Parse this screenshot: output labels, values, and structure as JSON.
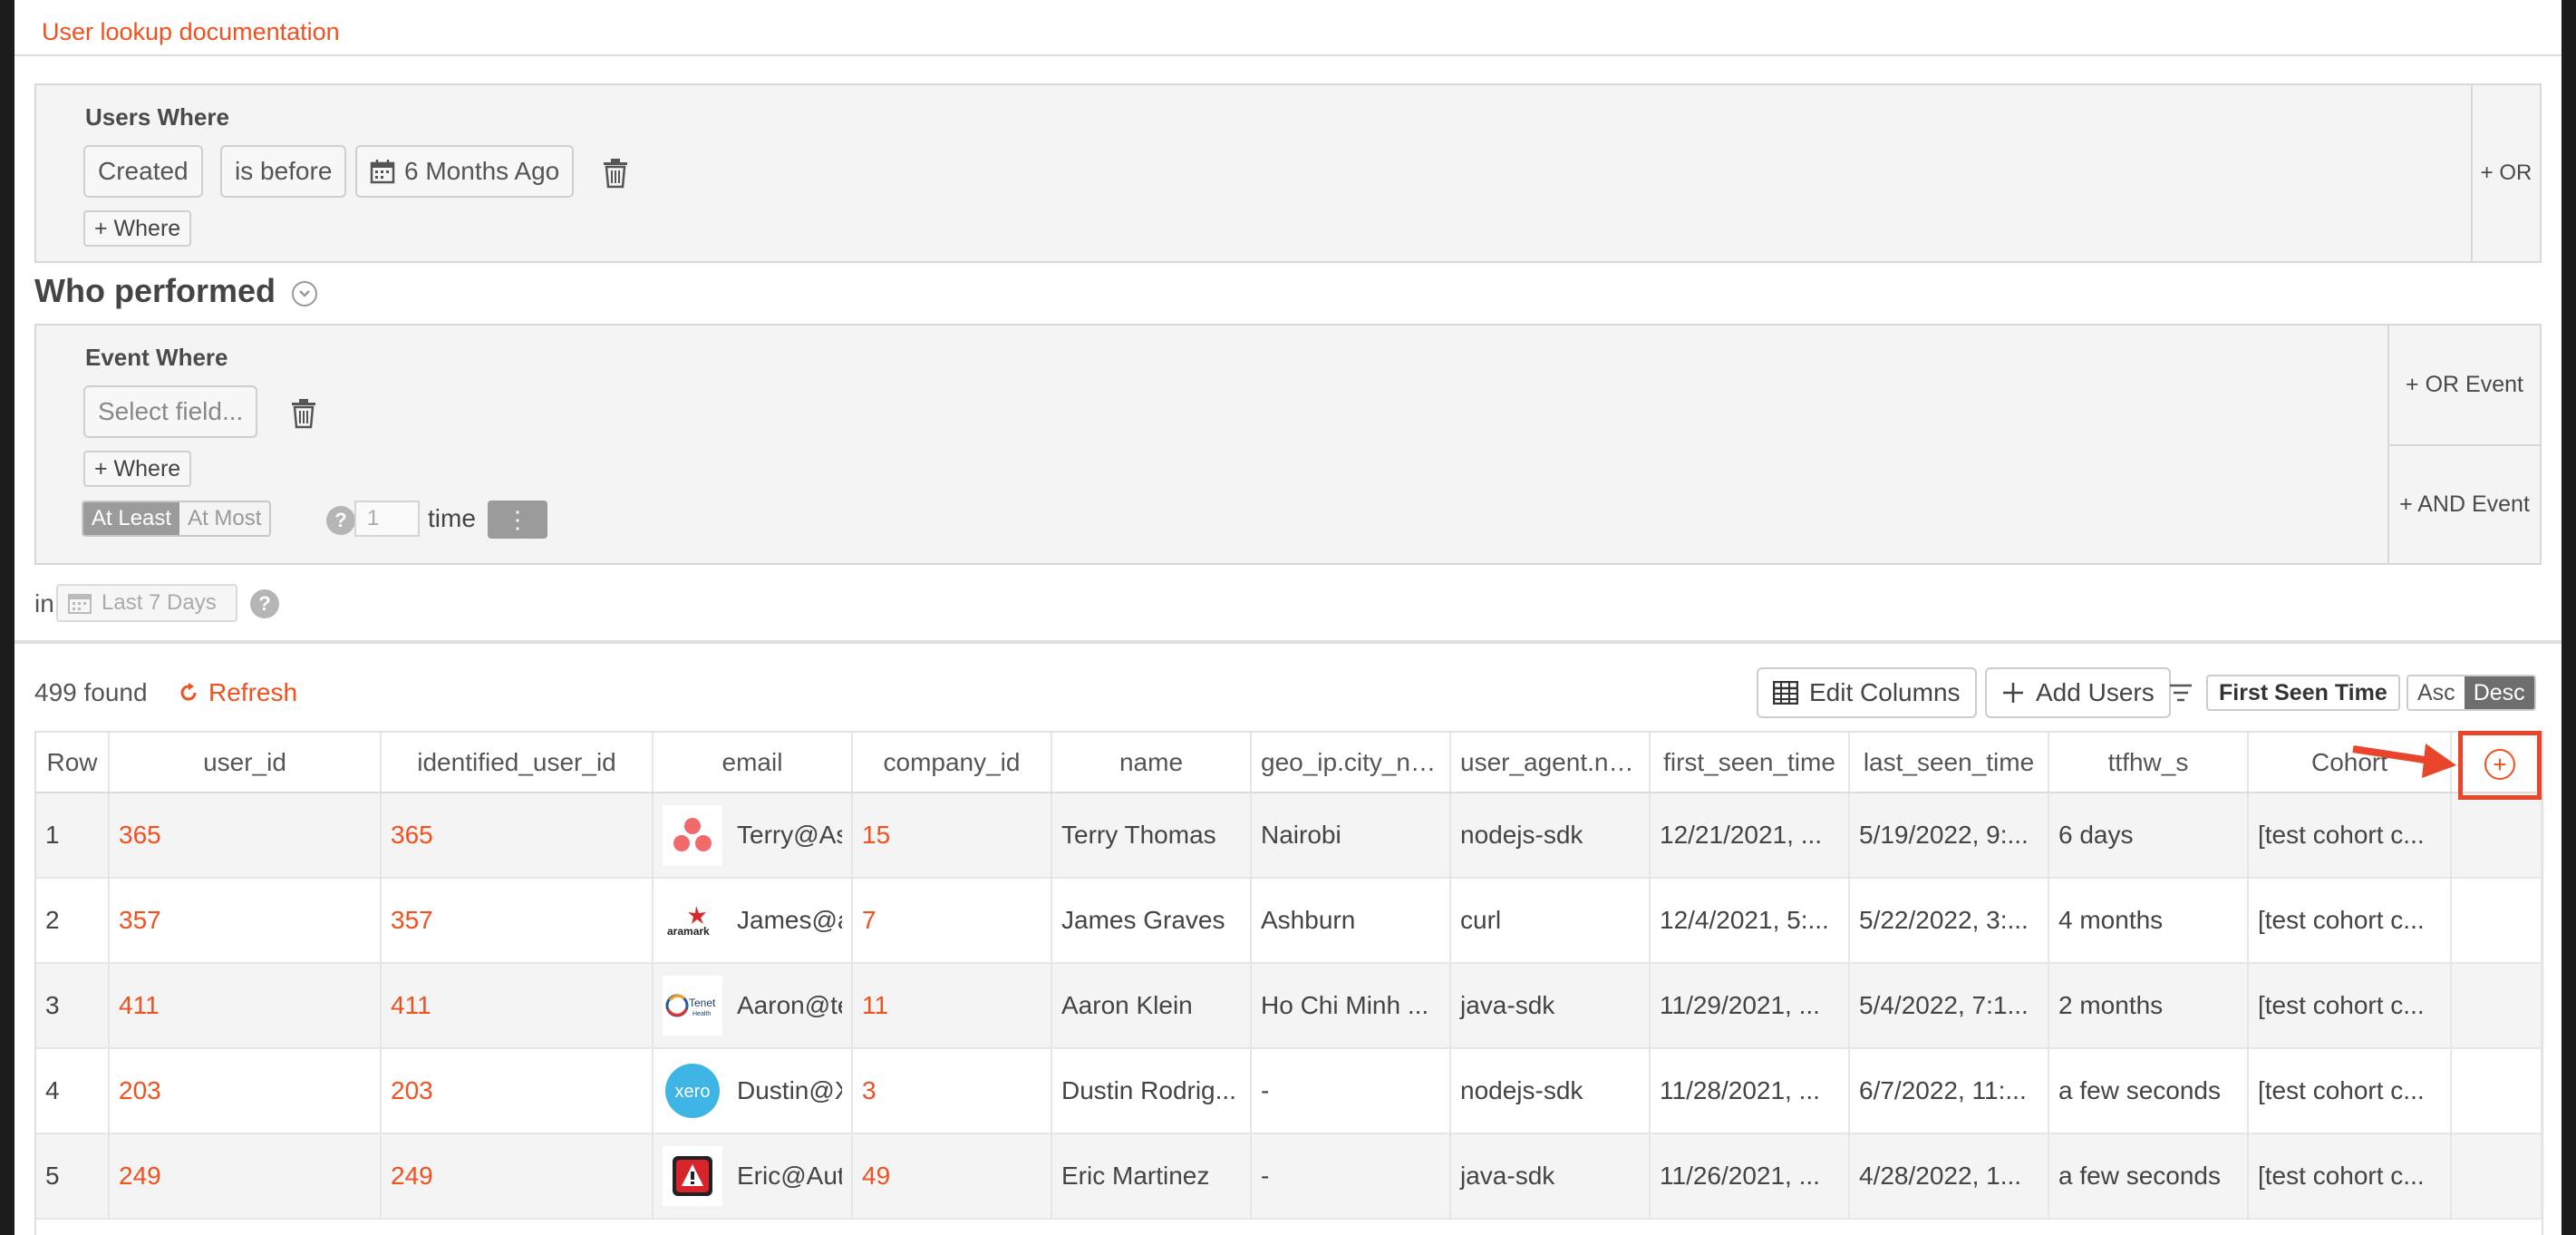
{
  "header": {
    "docs_link": "User lookup documentation"
  },
  "users_where": {
    "label": "Users Where",
    "field": "Created",
    "operator": "is before",
    "value": "6 Months Ago",
    "add_where": "+ Where",
    "or_label": "+ OR"
  },
  "who_performed": {
    "title": "Who performed",
    "event_label": "Event Where",
    "select_placeholder": "Select field...",
    "add_where": "+ Where",
    "at_least": "At Least",
    "at_most": "At Most",
    "count_placeholder": "1",
    "time_label": "time",
    "kebab": "⋮",
    "or_event": "+ OR Event",
    "and_event": "+ AND Event",
    "in_label": "in",
    "range": "Last 7 Days"
  },
  "results": {
    "found": "499 found",
    "refresh": "Refresh",
    "edit_columns": "Edit Columns",
    "add_users": "Add Users",
    "sort_field": "First Seen Time",
    "asc": "Asc",
    "desc": "Desc",
    "add_column_icon": "+"
  },
  "table": {
    "columns": [
      "Row",
      "user_id",
      "identified_user_id",
      "email",
      "company_id",
      "name",
      "geo_ip.city_na...",
      "user_agent.na...",
      "first_seen_time",
      "last_seen_time",
      "ttfhw_s",
      "Cohort"
    ],
    "rows": [
      {
        "row": "1",
        "user_id": "365",
        "identified_user_id": "365",
        "email": "Terry@Asa",
        "company_id": "15",
        "name": "Terry Thomas",
        "city": "Nairobi",
        "agent": "nodejs-sdk",
        "first_seen": "12/21/2021, ...",
        "last_seen": "5/19/2022, 9:...",
        "ttfhw": "6 days",
        "cohort": "[test cohort c...",
        "logo": "asana-logo"
      },
      {
        "row": "2",
        "user_id": "357",
        "identified_user_id": "357",
        "email": "James@a",
        "company_id": "7",
        "name": "James Graves",
        "city": "Ashburn",
        "agent": "curl",
        "first_seen": "12/4/2021, 5:...",
        "last_seen": "5/22/2022, 3:...",
        "ttfhw": "4 months",
        "cohort": "[test cohort c...",
        "logo": "aramark-logo"
      },
      {
        "row": "3",
        "user_id": "411",
        "identified_user_id": "411",
        "email": "Aaron@te",
        "company_id": "11",
        "name": "Aaron Klein",
        "city": "Ho Chi Minh ...",
        "agent": "java-sdk",
        "first_seen": "11/29/2021, ...",
        "last_seen": "5/4/2022, 7:1...",
        "ttfhw": "2 months",
        "cohort": "[test cohort c...",
        "logo": "tenet-logo"
      },
      {
        "row": "4",
        "user_id": "203",
        "identified_user_id": "203",
        "email": "Dustin@Xe",
        "company_id": "3",
        "name": "Dustin Rodrig...",
        "city": "-",
        "agent": "nodejs-sdk",
        "first_seen": "11/28/2021, ...",
        "last_seen": "6/7/2022, 11:...",
        "ttfhw": "a few seconds",
        "cohort": "[test cohort c...",
        "logo": "xero-logo"
      },
      {
        "row": "5",
        "user_id": "249",
        "identified_user_id": "249",
        "email": "Eric@Auto",
        "company_id": "49",
        "name": "Eric Martinez",
        "city": "-",
        "agent": "java-sdk",
        "first_seen": "11/26/2021, ...",
        "last_seen": "4/28/2022, 1...",
        "ttfhw": "a few seconds",
        "cohort": "[test cohort c...",
        "logo": "autodesk-logo"
      }
    ]
  },
  "logos": {
    "aramark": "aramark",
    "tenet": "Tenet",
    "tenet_sub": "Health",
    "xero": "xero"
  },
  "colors": {
    "accent": "#f0511f",
    "highlight": "#e8452a"
  }
}
